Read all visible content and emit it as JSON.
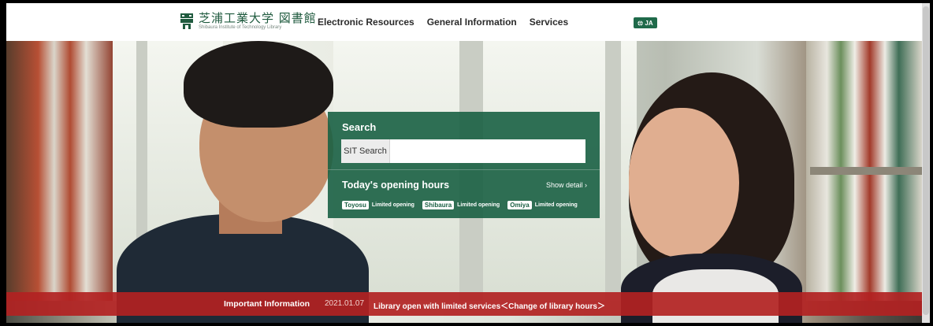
{
  "header": {
    "logo_jp": "芝浦工業大学 図書館",
    "logo_en": "Shibaura Institute of Technology Library",
    "nav": [
      "Electronic Resources",
      "General Information",
      "Services"
    ],
    "language": "JA"
  },
  "search": {
    "title": "Search",
    "scope": "SIT Search",
    "placeholder": ""
  },
  "hours": {
    "title": "Today's opening hours",
    "show_detail": "Show detail ›",
    "campuses": [
      {
        "name": "Toyosu",
        "status": "Limited opening"
      },
      {
        "name": "Shibaura",
        "status": "Limited opening"
      },
      {
        "name": "Omiya",
        "status": "Limited opening"
      }
    ]
  },
  "important": {
    "label": "Important Information",
    "date": "2021.01.07",
    "text": "Library open with limited services＜Change of library hours＞"
  },
  "colors": {
    "brand_green": "#1a6044",
    "important_red": "#b22222"
  }
}
